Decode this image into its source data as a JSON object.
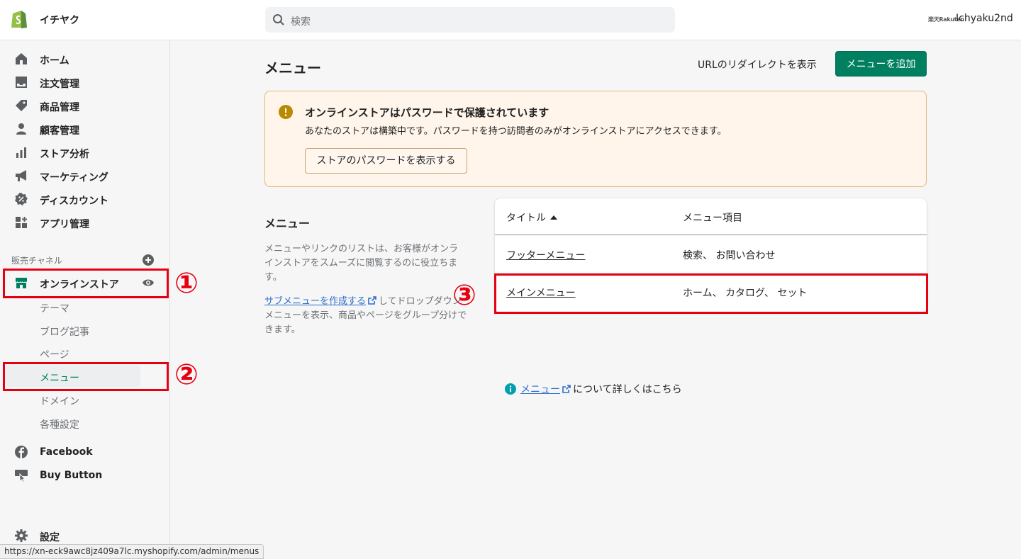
{
  "topbar": {
    "store_name": "イチヤク",
    "search_placeholder": "検索",
    "account_logo_text": "楽天Rakuten",
    "account_name": "Ichyaku2nd"
  },
  "sidebar": {
    "items": [
      {
        "label": "ホーム",
        "icon": "home-icon"
      },
      {
        "label": "注文管理",
        "icon": "orders-icon"
      },
      {
        "label": "商品管理",
        "icon": "tag-icon"
      },
      {
        "label": "顧客管理",
        "icon": "person-icon"
      },
      {
        "label": "ストア分析",
        "icon": "analytics-icon"
      },
      {
        "label": "マーケティング",
        "icon": "megaphone-icon"
      },
      {
        "label": "ディスカウント",
        "icon": "discount-icon"
      },
      {
        "label": "アプリ管理",
        "icon": "apps-icon"
      }
    ],
    "sales_channels_label": "販売チャネル",
    "online_store": "オンラインストア",
    "sub_items": [
      "テーマ",
      "ブログ記事",
      "ページ",
      "メニュー",
      "ドメイン",
      "各種設定"
    ],
    "facebook": "Facebook",
    "buy_button": "Buy Button",
    "settings": "設定"
  },
  "annotations": {
    "one": "①",
    "two": "②",
    "three": "③"
  },
  "main": {
    "title": "メニュー",
    "redirect_link": "URLのリダイレクトを表示",
    "add_button": "メニューを追加",
    "banner": {
      "title": "オンラインストアはパスワードで保護されています",
      "text": "あなたのストアは構築中です。パスワードを持つ訪問者のみがオンラインストアにアクセスできます。",
      "button": "ストアのパスワードを表示する"
    },
    "section": {
      "title": "メニュー",
      "description": "メニューやリンクのリストは、お客様がオンラインストアをスムーズに閲覧するのに役立ちます。",
      "submenu_link": "サブメニューを作成する",
      "submenu_text": "してドロップダウンメニューを表示、商品やページをグループ分けできます。"
    },
    "table": {
      "col_title": "タイトル",
      "col_items": "メニュー項目",
      "rows": [
        {
          "title": "フッターメニュー",
          "items": "検索、 お問い合わせ"
        },
        {
          "title": "メインメニュー",
          "items": "ホーム、 カタログ、 セット"
        }
      ]
    },
    "help": {
      "link": "メニュー",
      "text": "について詳しくはこちら"
    }
  },
  "status_bar": "https://xn-eck9awc8jz409a7lc.myshopify.com/admin/menus",
  "colors": {
    "primary": "#008060",
    "link": "#2c6ecb",
    "banner_bg": "#fff5ea",
    "annotation_red": "#e60012"
  }
}
